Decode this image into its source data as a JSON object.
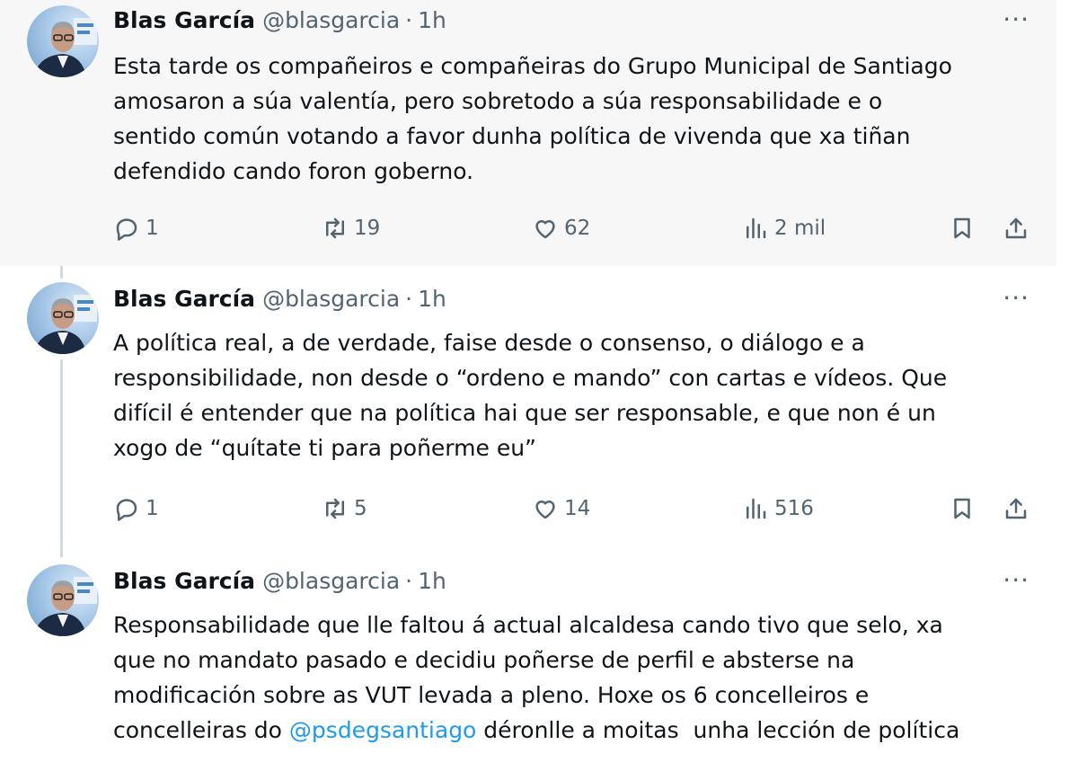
{
  "tweets": [
    {
      "author": {
        "name": "Blas García",
        "handle": "@blasgarcia",
        "time": "1h"
      },
      "text_lines": [
        "Esta tarde os compañeiros e compañeiras do Grupo Municipal de Santiago",
        "amosaron a súa valentía, pero sobretodo a súa responsabilidade e o",
        "sentido común votando a favor dunha política de vivenda que xa tiñan",
        "defendido cando foron goberno."
      ],
      "stats": {
        "replies": "1",
        "retweets": "19",
        "likes": "62",
        "views": "2 mil"
      }
    },
    {
      "author": {
        "name": "Blas García",
        "handle": "@blasgarcia",
        "time": "1h"
      },
      "text_lines": [
        "A política real, a de verdade, faise desde o consenso, o diálogo e a",
        "responsibilidade, non desde o “ordeno e mando” con cartas e vídeos. Que",
        "difícil é entender que na política hai que ser responsable, e que non é un",
        "xogo de “quítate ti para poñerme eu”"
      ],
      "stats": {
        "replies": "1",
        "retweets": "5",
        "likes": "14",
        "views": "516"
      }
    },
    {
      "author": {
        "name": "Blas García",
        "handle": "@blasgarcia",
        "time": "1h"
      },
      "text_lines": [
        "Responsabilidade que lle faltou á actual alcaldesa cando tivo que selo, xa",
        "que no mandato pasado e decidiu poñerse de perfil e absterse na",
        "modificación sobre as VUT levada a pleno. Hoxe os 6 concelleiros e"
      ],
      "last_line": {
        "before": "concelleiras do ",
        "mention": "@psdegsantiago",
        "after": " déronlle a moitas  unha lección de política"
      }
    }
  ],
  "ui": {
    "separator_dot": "·",
    "more_glyph": "···"
  },
  "icons": [
    "reply-icon",
    "retweet-icon",
    "like-icon",
    "views-icon",
    "bookmark-icon",
    "share-icon",
    "more-icon"
  ],
  "colors": {
    "text": "#0f1419",
    "secondary": "#536471",
    "link": "#1d9bf0",
    "highlight_bg": "#f7f7f7",
    "thread_line": "#cfd9de"
  }
}
